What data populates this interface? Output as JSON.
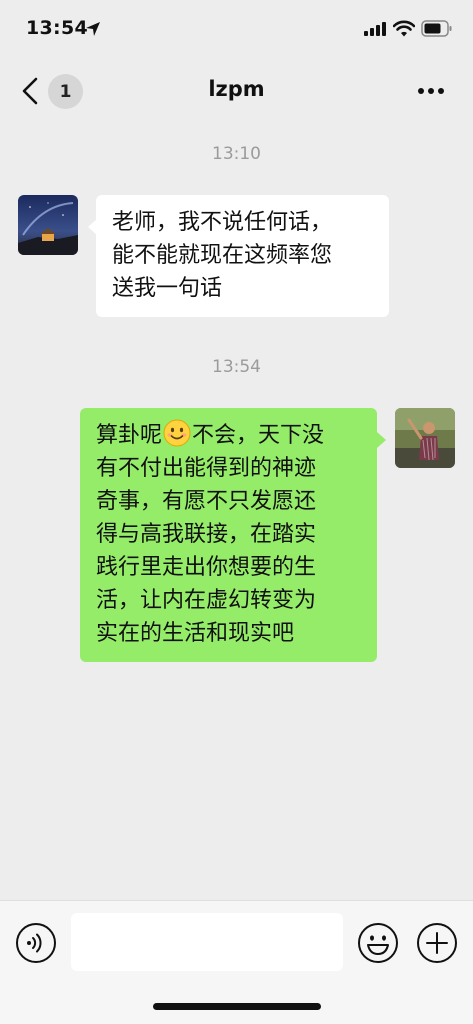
{
  "status_bar": {
    "time": "13:54"
  },
  "nav": {
    "unread_count": "1",
    "title": "lzpm"
  },
  "messages": [
    {
      "timestamp": "13:10",
      "direction": "incoming",
      "lines": [
        "老师，我不说任何话，",
        "能不能就现在这频率您",
        "送我一句话"
      ]
    },
    {
      "timestamp": "13:54",
      "direction": "outgoing",
      "line1_before_emoji": "算卦呢",
      "emoji": "smile-emoji",
      "line1_after_emoji": "不会，天下没",
      "lines": [
        "有不付出能得到的神迹",
        "奇事，有愿不只发愿还",
        "得与高我联接，在踏实",
        "践行里走出你想要的生",
        "活，让内在虚幻转变为",
        "实在的生活和现实吧"
      ]
    }
  ],
  "input_bar": {
    "placeholder": ""
  },
  "colors": {
    "background": "#ededed",
    "outgoing_bubble": "#95ec69",
    "incoming_bubble": "#ffffff"
  }
}
